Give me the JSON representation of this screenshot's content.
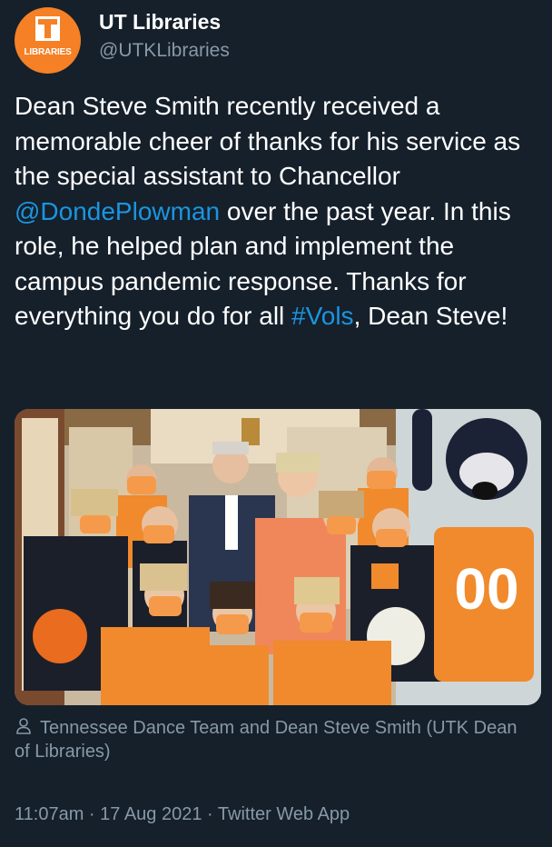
{
  "author": {
    "name": "UT Libraries",
    "handle": "@UTKLibraries",
    "avatar_label": "LIBRARIES",
    "avatar_color": "#f58025"
  },
  "tweet": {
    "text_1": "Dean Steve Smith recently received a memorable cheer of thanks for his service as the special assistant to Chancellor ",
    "mention": "@DondePlowman",
    "text_2": " over the past year. In this role, he helped plan and implement the campus pandemic response. Thanks for everything you do for all ",
    "hashtag": "#Vols",
    "text_3": ", Dean Steve!",
    "link_color": "#1b95e0"
  },
  "media": {
    "caption": "Tennessee Dance Team and Dean Steve Smith (UTK Dean of Libraries)",
    "caption_icon": "person-icon",
    "mascot_jersey": "00"
  },
  "meta": {
    "time": "11:07am",
    "separator_1": " · ",
    "date": "17 Aug 2021",
    "separator_2": " · ",
    "source": "Twitter Web App"
  },
  "colors": {
    "background": "#15202b",
    "secondary_text": "#8899a6",
    "primary_text": "#ffffff"
  }
}
